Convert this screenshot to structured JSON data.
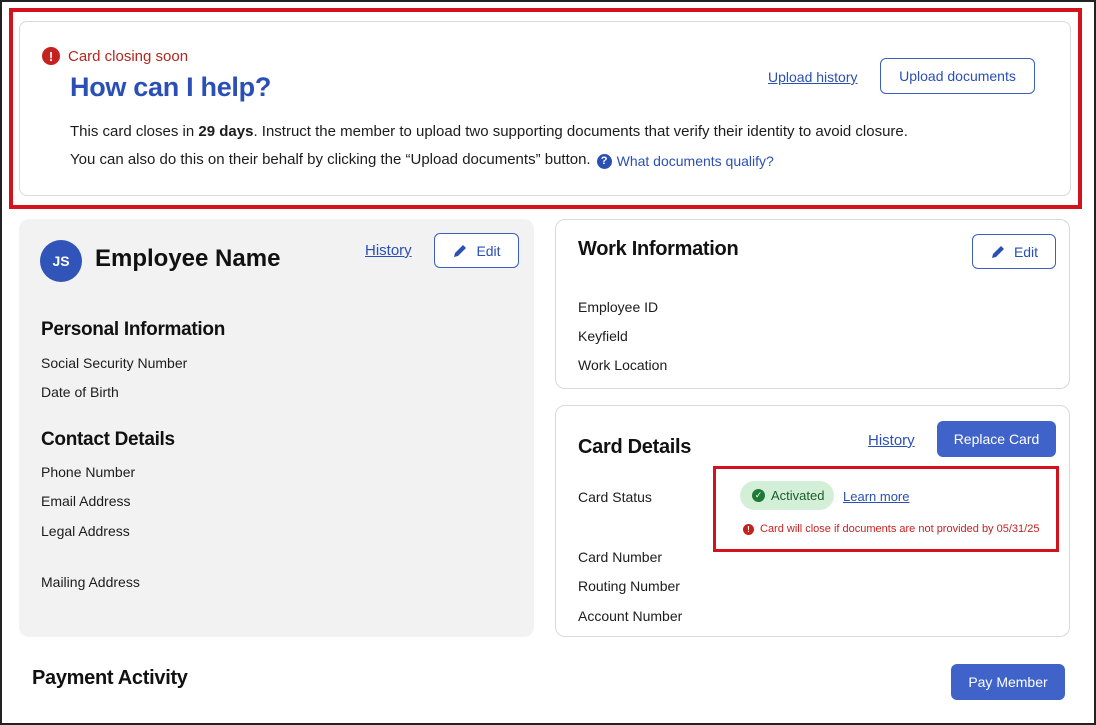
{
  "alert": {
    "error_icon": "exclamation-circle-icon",
    "status_text": "Card closing soon",
    "title": "How can I help?",
    "body_line1_prefix": "This card closes in ",
    "body_line1_days": "29 days",
    "body_line1_suffix": ". Instruct the member to upload two supporting documents that verify their identity to avoid closure.",
    "body_line2": "You can also do this on their behalf by clicking the “Upload documents” button.",
    "help_icon": "question-circle-icon",
    "help_link": "What documents qualify?",
    "upload_history_link": "Upload history",
    "upload_documents_button": "Upload documents"
  },
  "employee": {
    "avatar_initials": "JS",
    "name": "Employee Name",
    "history_link": "History",
    "edit_icon": "pencil-icon",
    "edit_button": "Edit",
    "personal_title": "Personal Information",
    "personal_fields": [
      "Social Security Number",
      "Date of Birth"
    ],
    "contact_title": "Contact Details",
    "contact_fields": [
      "Phone Number",
      "Email Address",
      "Legal Address",
      "Mailing Address"
    ]
  },
  "work": {
    "title": "Work Information",
    "edit_icon": "pencil-icon",
    "edit_button": "Edit",
    "fields": [
      "Employee ID",
      "Keyfield",
      "Work Location"
    ]
  },
  "card_details": {
    "title": "Card Details",
    "history_link": "History",
    "replace_button": "Replace Card",
    "status_label": "Card Status",
    "status_icon": "check-circle-icon",
    "status_value": "Activated",
    "learn_more_link": "Learn more",
    "warning_icon": "exclamation-circle-icon",
    "warning_text": "Card will close if documents are not provided by 05/31/25",
    "fields": [
      "Card Number",
      "Routing Number",
      "Account Number"
    ]
  },
  "payment": {
    "title": "Payment Activity",
    "pay_button": "Pay Member"
  },
  "colors": {
    "accent": "#2a4fb5",
    "button_fill": "#4063c9",
    "error": "#c5221f",
    "highlight_outline": "#d4121d",
    "success_bg": "#d4efd7"
  }
}
